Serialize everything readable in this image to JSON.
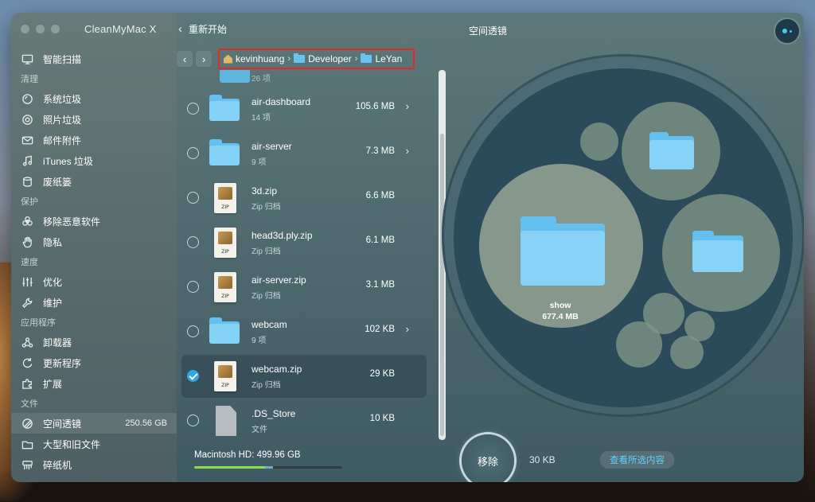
{
  "app": {
    "title": "CleanMyMac X",
    "back_label": "重新开始",
    "page_title": "空间透镜"
  },
  "sidebar": {
    "top": {
      "label": "智能扫描",
      "icon": "monitor-icon"
    },
    "sections": [
      {
        "title": "清理",
        "items": [
          {
            "label": "系统垃圾",
            "icon": "disk-icon"
          },
          {
            "label": "照片垃圾",
            "icon": "camera-icon"
          },
          {
            "label": "邮件附件",
            "icon": "mail-icon"
          },
          {
            "label": "iTunes 垃圾",
            "icon": "music-icon"
          },
          {
            "label": "废纸篓",
            "icon": "trash-icon"
          }
        ]
      },
      {
        "title": "保护",
        "items": [
          {
            "label": "移除恶意软件",
            "icon": "biohazard-icon"
          },
          {
            "label": "隐私",
            "icon": "hand-icon"
          }
        ]
      },
      {
        "title": "速度",
        "items": [
          {
            "label": "优化",
            "icon": "sliders-icon"
          },
          {
            "label": "维护",
            "icon": "wrench-icon"
          }
        ]
      },
      {
        "title": "应用程序",
        "items": [
          {
            "label": "卸载器",
            "icon": "uninstaller-icon"
          },
          {
            "label": "更新程序",
            "icon": "updater-icon"
          },
          {
            "label": "扩展",
            "icon": "extensions-icon"
          }
        ]
      },
      {
        "title": "文件",
        "items": [
          {
            "label": "空间透镜",
            "icon": "lens-icon",
            "size": "250.56 GB",
            "active": true
          },
          {
            "label": "大型和旧文件",
            "icon": "folder-icon"
          },
          {
            "label": "碎纸机",
            "icon": "shredder-icon"
          }
        ]
      }
    ]
  },
  "breadcrumb": [
    "kevinhuang",
    "Developer",
    "LeYan"
  ],
  "file_list": {
    "partial_top_sub": "26 项",
    "rows": [
      {
        "name": "air-dashboard",
        "sub": "14 项",
        "size": "105.6 MB",
        "type": "folder",
        "checked": false,
        "has_arrow": true
      },
      {
        "name": "air-server",
        "sub": "9 项",
        "size": "7.3 MB",
        "type": "folder",
        "checked": false,
        "has_arrow": true
      },
      {
        "name": "3d.zip",
        "sub": "Zip 归档",
        "size": "6.6 MB",
        "type": "zip",
        "checked": false,
        "has_arrow": false
      },
      {
        "name": "head3d.ply.zip",
        "sub": "Zip 归档",
        "size": "6.1 MB",
        "type": "zip",
        "checked": false,
        "has_arrow": false
      },
      {
        "name": "air-server.zip",
        "sub": "Zip 归档",
        "size": "3.1 MB",
        "type": "zip",
        "checked": false,
        "has_arrow": false
      },
      {
        "name": "webcam",
        "sub": "9 项",
        "size": "102 KB",
        "type": "folder",
        "checked": false,
        "has_arrow": true
      },
      {
        "name": "webcam.zip",
        "sub": "Zip 归档",
        "size": "29 KB",
        "type": "zip",
        "checked": true,
        "has_arrow": false
      },
      {
        "name": ".DS_Store",
        "sub": "文件",
        "size": "10 KB",
        "type": "doc",
        "checked": false,
        "has_arrow": false
      }
    ],
    "zip_label": "ZIP"
  },
  "disk": {
    "label": "Macintosh HD: 499.96 GB",
    "used_fraction": 0.48
  },
  "bubble": {
    "main_name": "show",
    "main_size": "677.4 MB"
  },
  "actions": {
    "remove_label": "移除",
    "selected_size": "30 KB",
    "view_selected_label": "查看所选内容"
  },
  "colors": {
    "accent": "#2ea6e6",
    "folder": "#63c0ef",
    "highlight_border": "#e12b2b"
  }
}
